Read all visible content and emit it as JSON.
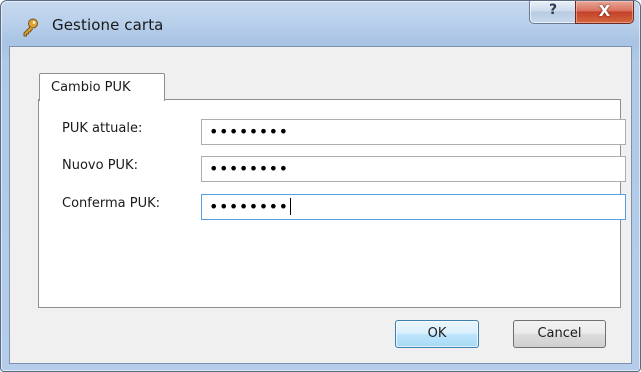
{
  "window": {
    "title": "Gestione carta",
    "icon": "key-icon",
    "help_label": "?",
    "close_label": "X"
  },
  "tabs": [
    {
      "label": "Cambio PUK",
      "selected": true
    }
  ],
  "form": {
    "current_puk": {
      "label": "PUK attuale:",
      "value": "••••••••"
    },
    "new_puk": {
      "label": "Nuovo PUK:",
      "value": "••••••••"
    },
    "confirm_puk": {
      "label": "Conferma PUK:",
      "value": "••••••••",
      "focused": true
    }
  },
  "buttons": {
    "ok_label": "OK",
    "cancel_label": "Cancel"
  },
  "colors": {
    "frame": "#b5cdea",
    "close_button": "#c4412a",
    "focus_border": "#569de5",
    "default_button": "#bee6fd"
  }
}
